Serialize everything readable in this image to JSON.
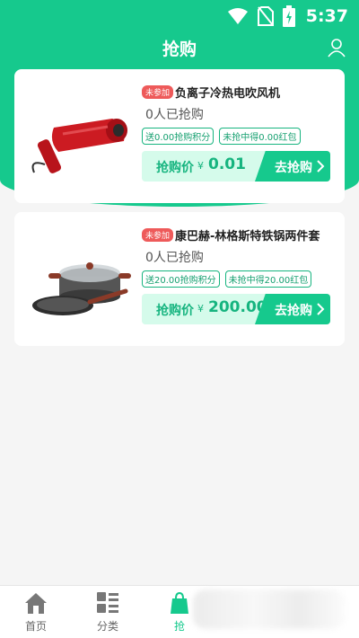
{
  "status_bar": {
    "time": "5:37"
  },
  "header": {
    "title": "抢购"
  },
  "cards": [
    {
      "badge": "未参加",
      "name": "负离子冷热电吹风机",
      "count_text": "0人已抢购",
      "tags": [
        "送0.00抢购积分",
        "未抢中得0.00红包"
      ],
      "price_label": "抢购价",
      "currency": "¥",
      "price": "0.01",
      "button_label": "去抢购"
    },
    {
      "badge": "未参加",
      "name": "康巴赫-林格斯特铁锅两件套",
      "count_text": "0人已抢购",
      "tags": [
        "送20.00抢购积分",
        "未抢中得20.00红包"
      ],
      "price_label": "抢购价",
      "currency": "¥",
      "price": "200.00",
      "button_label": "去抢购"
    }
  ],
  "tabbar": {
    "items": [
      {
        "label": "首页",
        "icon": "home-icon"
      },
      {
        "label": "分类",
        "icon": "category-icon"
      },
      {
        "label": "抢",
        "icon": "flash-sale-icon",
        "active": true
      }
    ]
  },
  "colors": {
    "accent": "#16c98d",
    "badge": "#ee5a5a",
    "price_bg": "#d5fbeb"
  }
}
